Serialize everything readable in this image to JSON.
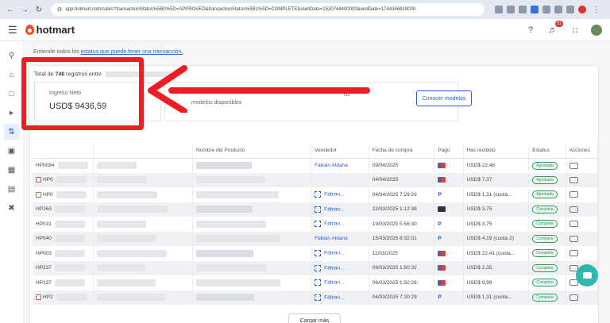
{
  "browser": {
    "url": "app.hotmart.com/sales?transactionStatus%5B0%5D=APPROVED&transactionStatus%5B1%5D=COMPLETE&startDate=1520744400000&endDate=1744346619000"
  },
  "header": {
    "logo": "hotmart",
    "notification_count": "51",
    "icons": [
      "help-icon",
      "bell-icon",
      "apps-icon",
      "avatar"
    ]
  },
  "sidebar": {
    "icons": [
      "search-icon",
      "home-icon",
      "folder-icon",
      "megaphone-icon",
      "sales-icon",
      "wallet-icon",
      "chart-icon",
      "document-icon",
      "tools-icon"
    ]
  },
  "info": {
    "prefix": "Entiende todos los",
    "link": "estatus que puede tener una transacción."
  },
  "summary": {
    "total_prefix": "Total de",
    "total_count": "746",
    "total_suffix": "registros entre",
    "kpi_label": "Ingreso Neto",
    "kpi_value": "USD$ 9436,59"
  },
  "promo": {
    "text1": "os",
    "text2": "modelos disponibles",
    "button": "Conocer modelos"
  },
  "table": {
    "headers": [
      "",
      "Nombre del Producto",
      "Vendedor",
      "Fecha de compra",
      "Pago",
      "Has recibido",
      "Estatus",
      "Acciones"
    ],
    "rows": [
      {
        "code": "HP0084",
        "vendor": "Fábian Aldana",
        "date": "09/04/2025",
        "pay": "multi",
        "received": "USD$ 22,48",
        "status": "Aprobada"
      },
      {
        "code": "HP0",
        "vendor": "",
        "date": "04/04/2025",
        "pay": "multi",
        "received": "USD$ 7,37",
        "status": "Aprobada"
      },
      {
        "code": "HP0",
        "vendor": "Fábian...",
        "date": "04/04/2025 7:29:29",
        "pay": "pp",
        "received": "USD$ 1,31 (cuota...",
        "status": "Aprobada"
      },
      {
        "code": "HP263",
        "vendor": "Fábian...",
        "date": "22/03/2025 1:12:36",
        "pay": "card",
        "received": "USD$ 3,75",
        "status": "Completa"
      },
      {
        "code": "HP031",
        "vendor": "Fábian...",
        "date": "19/03/2025 5:56:30",
        "pay": "pp",
        "received": "USD$ 3,75",
        "status": "Completa"
      },
      {
        "code": "HP040",
        "vendor": "Fábian Aldana",
        "date": "15/03/2025 8:32:01",
        "pay": "pp",
        "received": "USD$ 4,19 (cuota 2)",
        "status": "Completa"
      },
      {
        "code": "HP003",
        "vendor": "Fábian...",
        "date": "11/03/2025",
        "pay": "multi",
        "received": "USD$ 22,41 (cuota...",
        "status": "Completa"
      },
      {
        "code": "HP237",
        "vendor": "Fábian...",
        "date": "06/03/2025 1:50:32",
        "pay": "multi",
        "received": "USD$ 2,35",
        "status": "Completa"
      },
      {
        "code": "HP237",
        "vendor": "Fábian...",
        "date": "06/03/2025 1:50:28",
        "pay": "multi",
        "received": "USD$ 9,99",
        "status": "Completa"
      },
      {
        "code": "HP2",
        "vendor": "Fábian...",
        "date": "04/03/2025 7:30:29",
        "pay": "pp",
        "received": "USD$ 1,31 (cuota...",
        "status": "Completa"
      }
    ]
  },
  "load_more": "Cargar más",
  "colors": {
    "accent": "#2a62c7",
    "annotation": "#ee1d23",
    "brand": "#f04e23",
    "status_green": "#2e9b5b"
  }
}
